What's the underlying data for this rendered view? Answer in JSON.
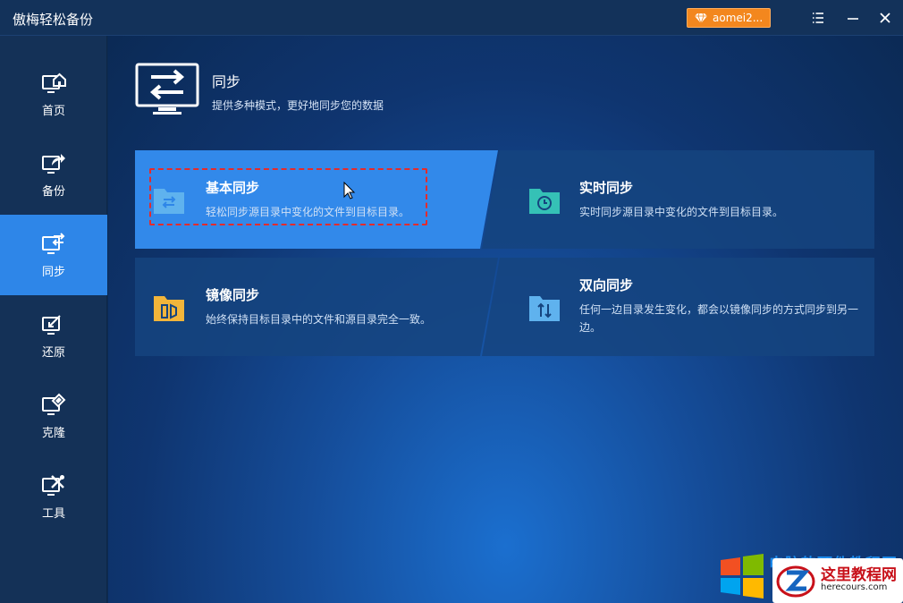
{
  "app": {
    "title": "傲梅轻松备份"
  },
  "titlebar": {
    "user": "aomei2..."
  },
  "sidebar": {
    "items": [
      {
        "label": "首页",
        "icon": "home-icon"
      },
      {
        "label": "备份",
        "icon": "backup-icon"
      },
      {
        "label": "同步",
        "icon": "sync-icon",
        "active": true
      },
      {
        "label": "还原",
        "icon": "restore-icon"
      },
      {
        "label": "克隆",
        "icon": "clone-icon"
      },
      {
        "label": "工具",
        "icon": "tools-icon"
      }
    ]
  },
  "header": {
    "title": "同步",
    "subtitle": "提供多种模式，更好地同步您的数据"
  },
  "cards": {
    "basic": {
      "title": "基本同步",
      "desc": "轻松同步源目录中变化的文件到目标目录。"
    },
    "realtime": {
      "title": "实时同步",
      "desc": "实时同步源目录中变化的文件到目标目录。"
    },
    "mirror": {
      "title": "镜像同步",
      "desc": "始终保持目标目录中的文件和源目录完全一致。"
    },
    "twoway": {
      "title": "双向同步",
      "desc": "任何一边目录发生变化，都会以镜像同步的方式同步到另一边。"
    }
  },
  "watermark": {
    "line1": "电脑软硬件教程网",
    "line2": "这里教程网",
    "url": "herecours.com"
  },
  "colors": {
    "accent": "#2e86e8",
    "badge": "#f3871e",
    "highlight": "#e52b2b",
    "folder_blue": "#5fb2ee",
    "folder_teal": "#35c1b6",
    "folder_yellow": "#f2b53b"
  }
}
